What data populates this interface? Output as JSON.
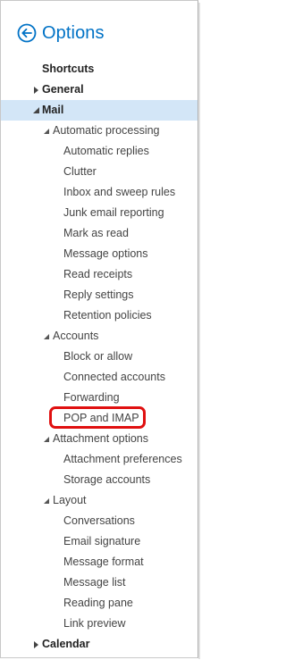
{
  "header": {
    "title": "Options",
    "back_icon": "back-arrow-circle-icon",
    "accent_color": "#0072c6"
  },
  "tree": {
    "shortcuts": "Shortcuts",
    "general": "General",
    "mail": "Mail",
    "automatic_processing": {
      "label": "Automatic processing",
      "items": [
        "Automatic replies",
        "Clutter",
        "Inbox and sweep rules",
        "Junk email reporting",
        "Mark as read",
        "Message options",
        "Read receipts",
        "Reply settings",
        "Retention policies"
      ]
    },
    "accounts": {
      "label": "Accounts",
      "items": [
        "Block or allow",
        "Connected accounts",
        "Forwarding",
        "POP and IMAP"
      ]
    },
    "attachment_options": {
      "label": "Attachment options",
      "items": [
        "Attachment preferences",
        "Storage accounts"
      ]
    },
    "layout": {
      "label": "Layout",
      "items": [
        "Conversations",
        "Email signature",
        "Message format",
        "Message list",
        "Reading pane",
        "Link preview"
      ]
    },
    "calendar": "Calendar"
  },
  "colors": {
    "selected_background": "#d3e6f7",
    "highlight_ring": "#e01010"
  }
}
